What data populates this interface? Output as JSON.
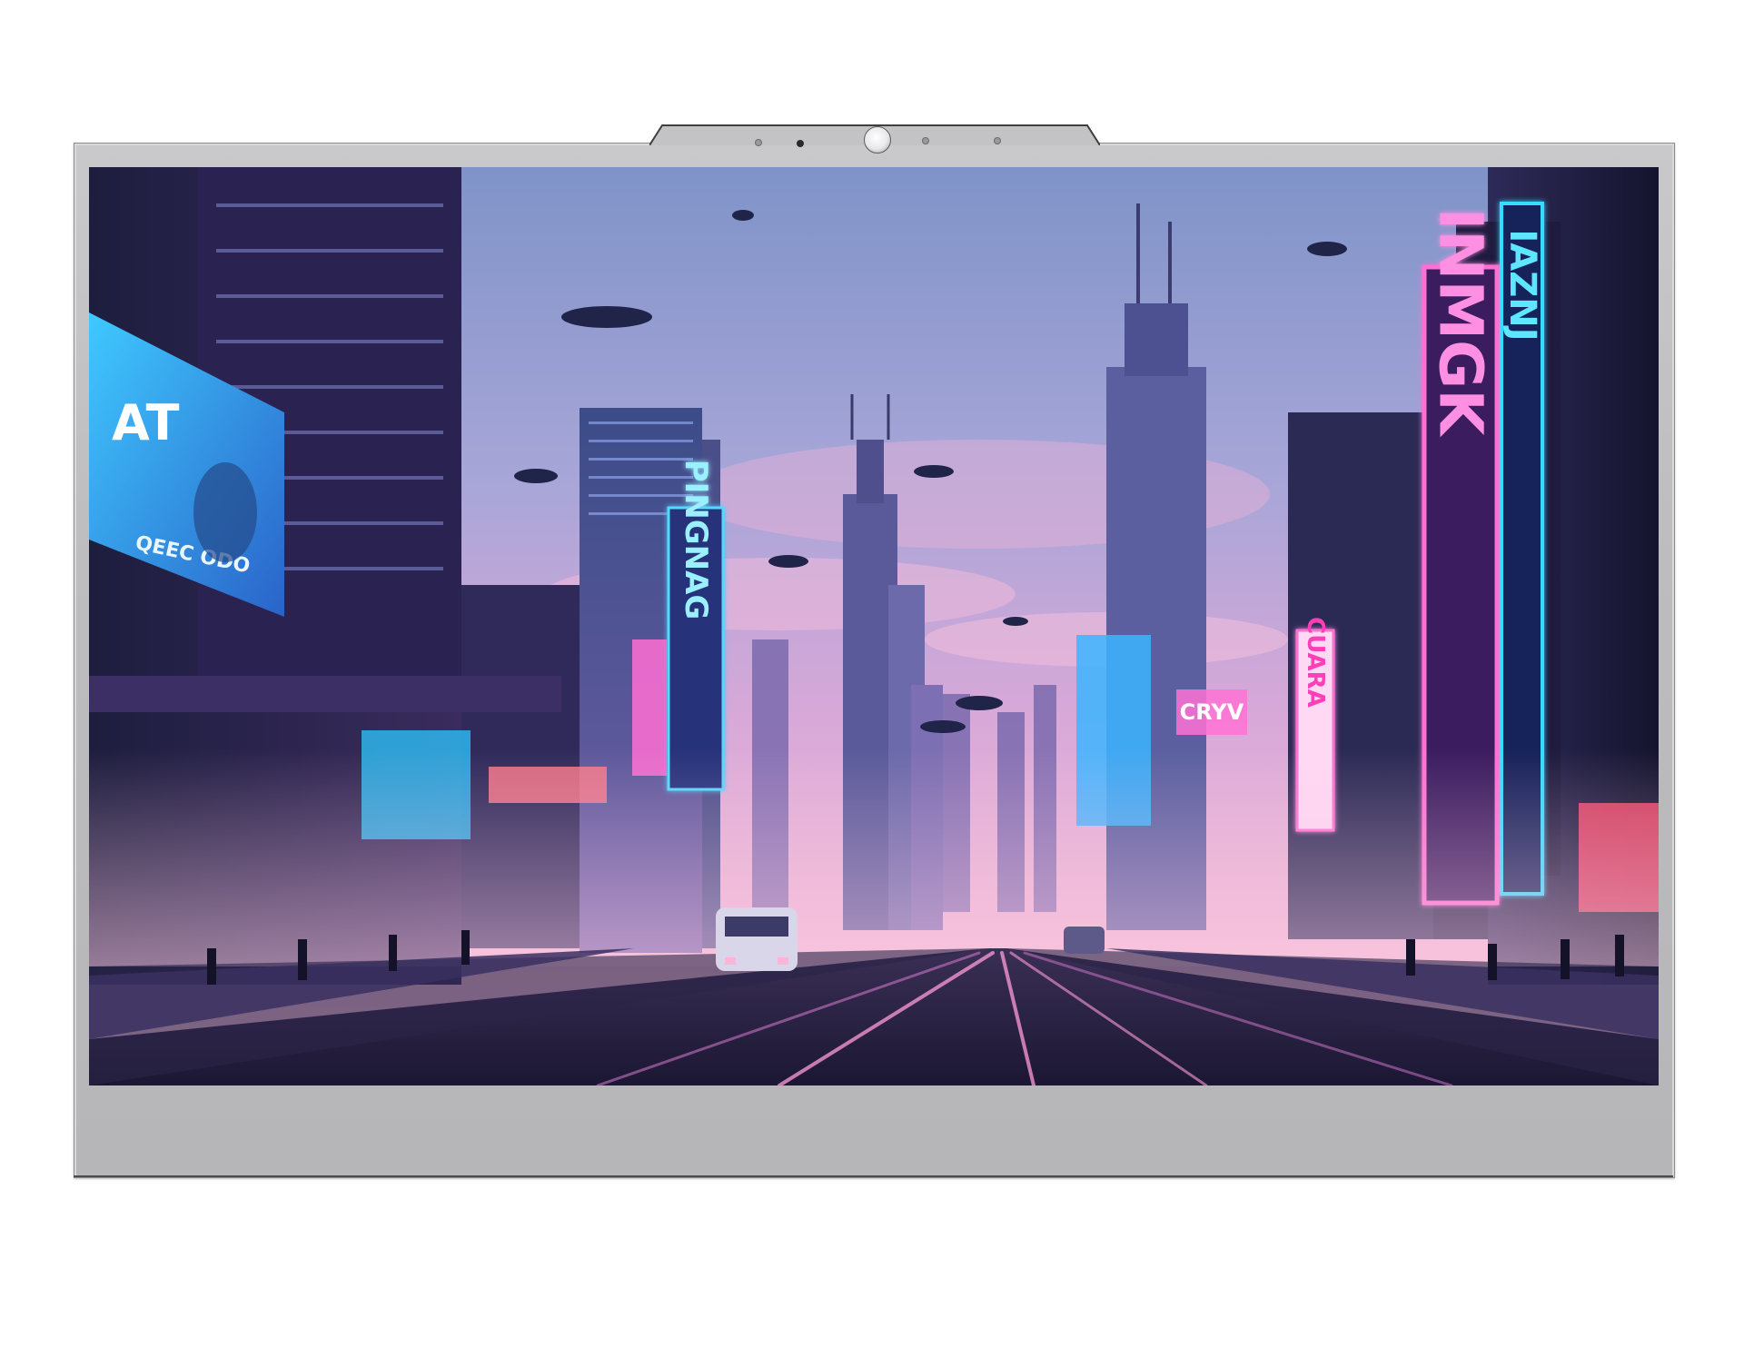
{
  "device": {
    "frame_color": "#c2c2c4",
    "camera_icon": "webcam-lens-icon"
  },
  "scene": {
    "description_type": "cyberpunk-city-street",
    "signs": {
      "left_billboard_text": "QEEC ODO",
      "left_billboard_logo": "AT",
      "tower_sign_vertical": "PINGNAG",
      "center_right_sign": "CRYV",
      "right_vertical_sign": "CUARA",
      "big_pink_sign": "INMGK",
      "big_blue_sign": "IAZNJ"
    },
    "colors": {
      "sky_top": "#7d8fc4",
      "sky_mid": "#c7a3d6",
      "sky_horizon": "#f0b8d8",
      "neon_pink": "#ff5fd2",
      "neon_blue": "#2fd6ff",
      "road": "#2a2440"
    }
  }
}
